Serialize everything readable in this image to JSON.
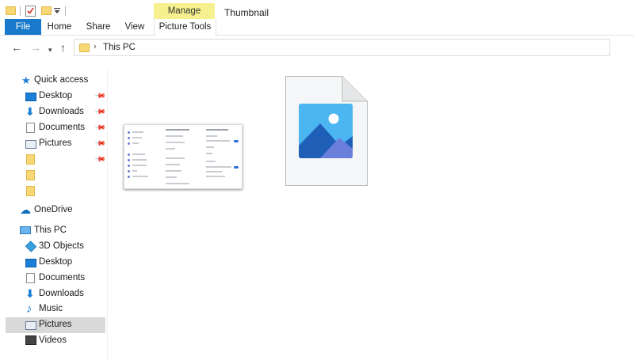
{
  "titlebar": {
    "manage_tab": "Manage",
    "window_title": "Thumbnail"
  },
  "ribbon": {
    "tabs": [
      "File",
      "Home",
      "Share",
      "View",
      "Picture Tools"
    ]
  },
  "address": {
    "path": "This PC"
  },
  "navpane": {
    "quick_access": "Quick access",
    "quick_items": [
      {
        "label": "Desktop",
        "icon": "desktop-icon"
      },
      {
        "label": "Downloads",
        "icon": "download-icon"
      },
      {
        "label": "Documents",
        "icon": "document-icon"
      },
      {
        "label": "Pictures",
        "icon": "pictures-icon"
      }
    ],
    "onedrive": "OneDrive",
    "this_pc": "This PC",
    "pc_items": [
      {
        "label": "3D Objects",
        "icon": "cube-icon"
      },
      {
        "label": "Desktop",
        "icon": "desktop-icon"
      },
      {
        "label": "Documents",
        "icon": "document-icon"
      },
      {
        "label": "Downloads",
        "icon": "download-icon"
      },
      {
        "label": "Music",
        "icon": "music-icon"
      },
      {
        "label": "Pictures",
        "icon": "pictures-icon",
        "selected": true
      },
      {
        "label": "Videos",
        "icon": "video-icon"
      }
    ]
  },
  "colors": {
    "accent": "#1979ca",
    "manage": "#f6f18e",
    "selected": "#d9d9d9",
    "folder": "#f8d775"
  }
}
